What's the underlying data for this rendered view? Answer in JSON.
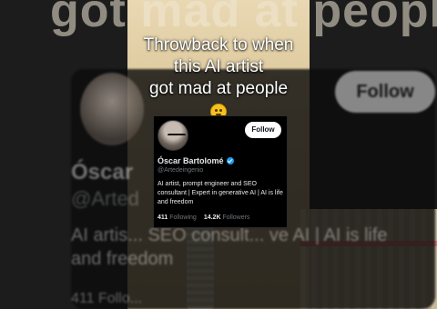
{
  "background": {
    "top_text": "got mad at people",
    "ghost_follow": "Follow",
    "ghost_name": "Óscar",
    "ghost_handle": "@Arted",
    "ghost_bio": "AI artis... SEO consult... ve AI | AI is life and freedom",
    "ghost_stats": "411 Follo..."
  },
  "caption": {
    "line1": "Throwback to when",
    "line2": "this AI artist",
    "line3": "got mad at people",
    "emoji": "neutral-face-emoji"
  },
  "profile": {
    "follow_label": "Follow",
    "name": "Óscar Bartolomé",
    "handle": "@Artedeingenio",
    "bio": "AI artist, prompt engineer and SEO consultant | Expert in generative AI | AI is life and freedom",
    "following_count": "411",
    "following_label": "Following",
    "followers_count": "14.2K",
    "followers_label": "Followers",
    "verified_color": "#1d9bf0"
  }
}
